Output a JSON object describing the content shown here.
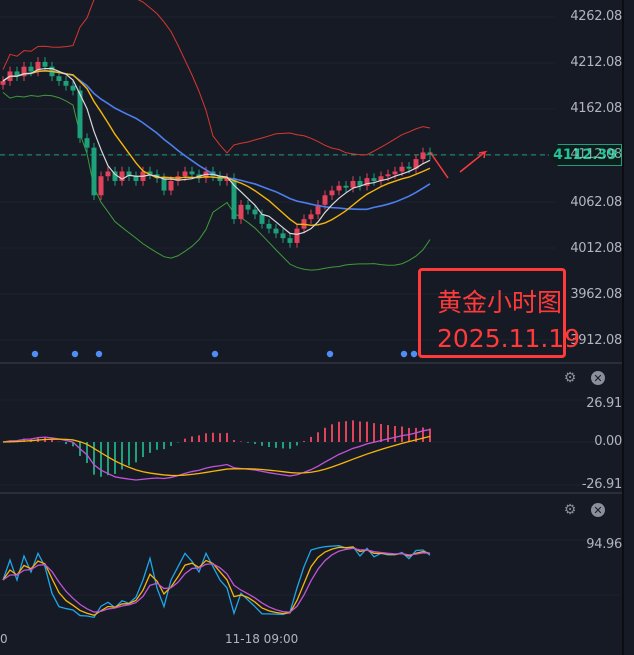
{
  "price_axis": [
    "4262.08",
    "4212.08",
    "4162.08",
    "4112.08",
    "4062.08",
    "4012.08",
    "3962.08",
    "3912.08"
  ],
  "current_price": "4112.39",
  "macd_axis": [
    "26.91",
    "0.00",
    "-26.91"
  ],
  "osc_axis": [
    "94.96"
  ],
  "time_axis": [
    "0",
    "11-18 09:00"
  ],
  "annotation": {
    "title": "黄金小时图",
    "date": "2025.11.19"
  },
  "icons": {
    "settings": "gear-icon",
    "close": "close-icon"
  },
  "colors": {
    "up": "#e0435a",
    "down": "#1ea07a",
    "ma_fast": "#d9d9d9",
    "ma_mid": "#f5b50a",
    "ma_slow": "#4d7ef0",
    "bollinger_upper": "#d8372f",
    "bollinger_lower": "#3f9a3a",
    "annotation": "#ff3a3a"
  },
  "chart_data": {
    "type": "candlestick",
    "closes": [
      4190,
      4200,
      4195,
      4205,
      4200,
      4210,
      4205,
      4195,
      4190,
      4185,
      4180,
      4130,
      4120,
      4070,
      4090,
      4095,
      4085,
      4095,
      4090,
      4085,
      4095,
      4092,
      4088,
      4075,
      4085,
      4090,
      4095,
      4092,
      4088,
      4095,
      4090,
      4085,
      4088,
      4045,
      4060,
      4055,
      4050,
      4040,
      4035,
      4030,
      4025,
      4020,
      4035,
      4045,
      4050,
      4060,
      4070,
      4075,
      4080,
      4078,
      4085,
      4080,
      4088,
      4085,
      4090,
      4092,
      4095,
      4100,
      4098,
      4108,
      4115,
      4112.39
    ],
    "ylim": [
      3895,
      4275
    ]
  }
}
